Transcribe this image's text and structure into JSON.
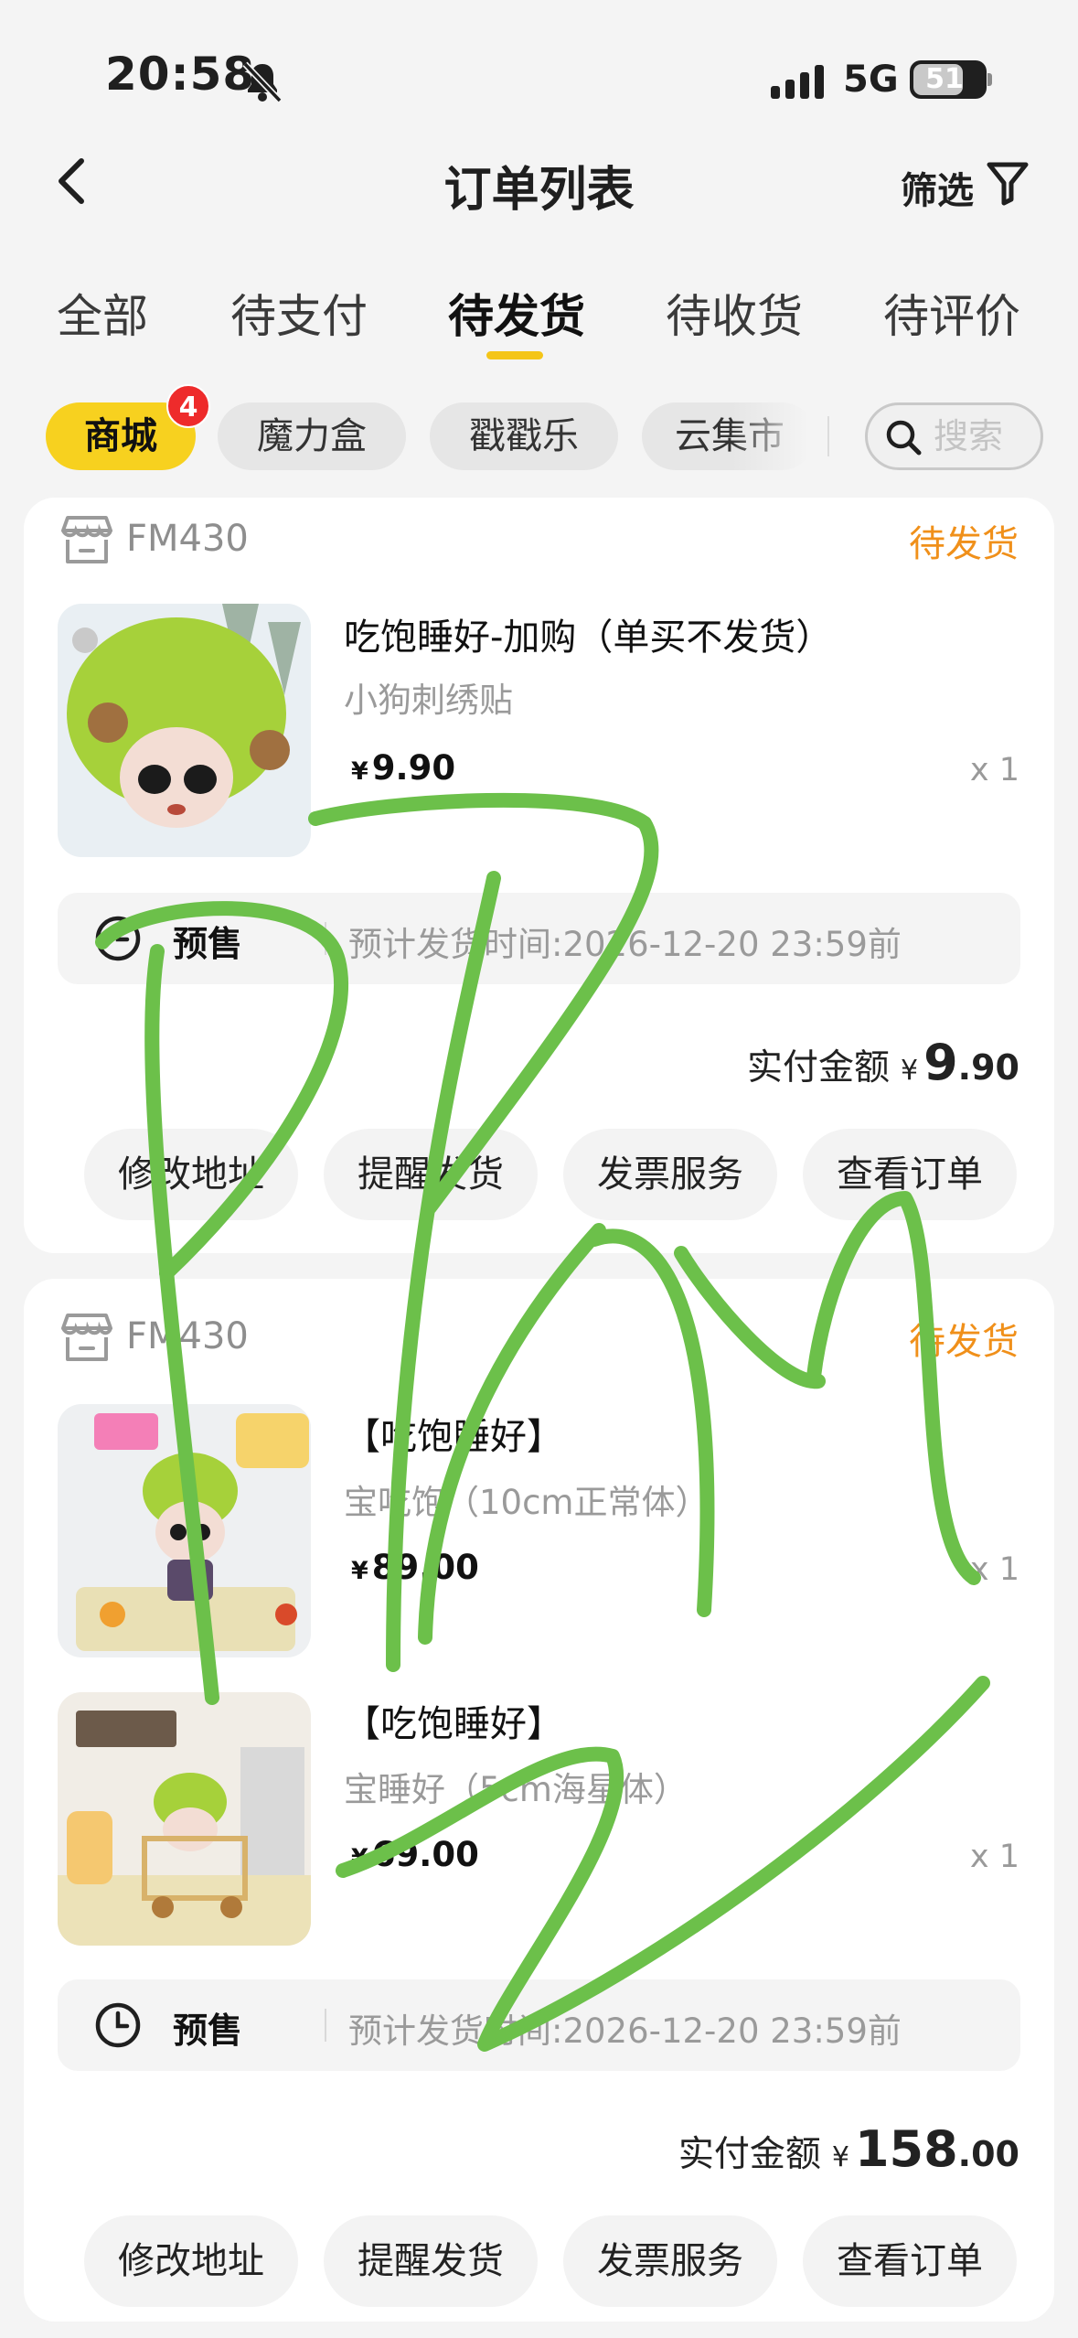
{
  "status_bar": {
    "time": "20:58",
    "network": "5G",
    "battery": "51"
  },
  "nav": {
    "title": "订单列表",
    "filter_label": "筛选"
  },
  "tabs": [
    {
      "label": "全部"
    },
    {
      "label": "待支付"
    },
    {
      "label": "待发货",
      "active": true
    },
    {
      "label": "待收货"
    },
    {
      "label": "待评价"
    }
  ],
  "chips": [
    {
      "label": "商城",
      "badge": "4",
      "active": true
    },
    {
      "label": "魔力盒"
    },
    {
      "label": "戳戳乐"
    },
    {
      "label": "云集市"
    }
  ],
  "search": {
    "placeholder": "搜索"
  },
  "orders": [
    {
      "store": "FM430",
      "status": "待发货",
      "items": [
        {
          "title": "吃饱睡好-加购（单买不发货）",
          "spec": "小狗刺绣贴",
          "currency": "¥",
          "price": "9.90",
          "qty": "x 1"
        }
      ],
      "presale_label": "预售",
      "eta": "预计发货时间:2026-12-20 23:59前",
      "total_label": "实付金额",
      "total_currency": "¥",
      "total_int": "9",
      "total_dec": ".90",
      "buttons": [
        "修改地址",
        "提醒发货",
        "发票服务",
        "查看订单"
      ]
    },
    {
      "store": "FM430",
      "status": "待发货",
      "items": [
        {
          "title": "【吃饱睡好】",
          "spec": "宝吃饱（10cm正常体）",
          "currency": "¥",
          "price": "89.00",
          "qty": "x 1"
        },
        {
          "title": "【吃饱睡好】",
          "spec": "宝睡好（5cm海星体）",
          "currency": "¥",
          "price": "69.00",
          "qty": "x 1"
        }
      ],
      "presale_label": "预售",
      "eta": "预计发货时间:2026-12-20 23:59前",
      "total_label": "实付金额",
      "total_currency": "¥",
      "total_int": "158",
      "total_dec": ".00",
      "buttons": [
        "修改地址",
        "提醒发货",
        "发票服务",
        "查看订单"
      ]
    }
  ],
  "colors": {
    "accent_yellow": "#f7d11f",
    "status_orange": "#f0901a",
    "badge_red": "#ee2b2b",
    "scribble_green": "#6cc04a"
  },
  "icons": [
    "bell-off-icon",
    "signal-icon",
    "back-chevron-icon",
    "funnel-icon",
    "search-icon",
    "store-icon",
    "clock-icon"
  ]
}
